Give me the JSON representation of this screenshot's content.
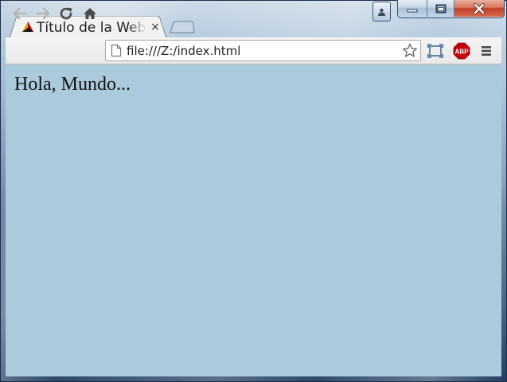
{
  "window": {
    "controls": {
      "profile_icon": "profile-icon",
      "minimize_icon": "minimize-icon",
      "maximize_icon": "maximize-icon",
      "close_icon": "close-icon"
    }
  },
  "tab": {
    "title": "Título de la Web",
    "close_label": "×",
    "favicon": "triangle-favicon"
  },
  "toolbar": {
    "back_icon": "back-arrow-icon",
    "forward_icon": "forward-arrow-icon",
    "reload_icon": "reload-icon",
    "home_icon": "home-icon",
    "address": "file:///Z:/index.html",
    "star_icon": "star-icon",
    "cast_icon": "fullscreen-icon",
    "adblock_label": "ABP",
    "menu_icon": "hamburger-menu-icon"
  },
  "page": {
    "text": "Hola, Mundo...",
    "background": "#abcadc"
  },
  "colors": {
    "adblock_red": "#c4000a",
    "close_red": "#c2402a"
  }
}
